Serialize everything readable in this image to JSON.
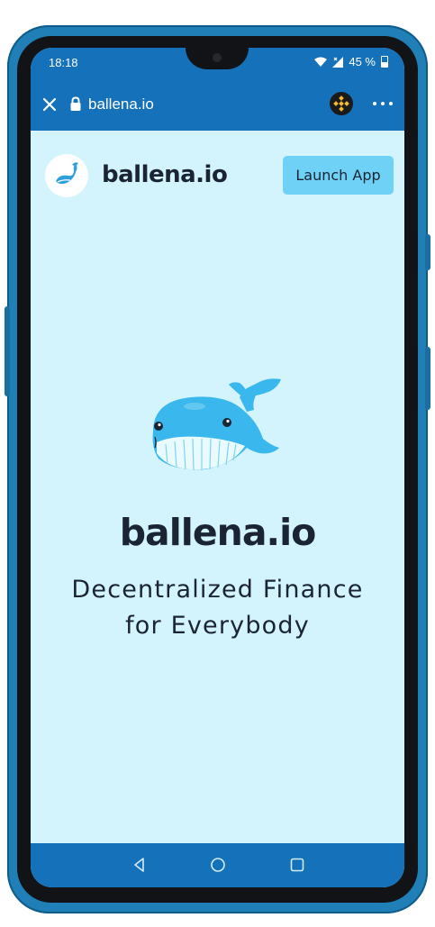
{
  "status_bar": {
    "time": "18:18",
    "battery": "45 %",
    "icons": [
      "wifi-icon",
      "signal-icon",
      "battery-icon"
    ]
  },
  "browser_bar": {
    "url": "ballena.io",
    "icons": [
      "close-icon",
      "lock-icon",
      "binance-icon",
      "more-icon"
    ]
  },
  "header": {
    "brand": "ballena.io",
    "launch_button": "Launch App"
  },
  "hero": {
    "title": "ballena.io",
    "subtitle_line1": "Decentralized Finance",
    "subtitle_line2": "for Everybody"
  },
  "nav_bar": {
    "icons": [
      "back-icon",
      "home-icon",
      "recents-icon"
    ]
  },
  "colors": {
    "chrome_blue": "#1571b9",
    "page_background": "#d3f3fd",
    "button_cyan": "#6fd1f5",
    "text_dark": "#1b2433",
    "whale_blue": "#39b6ea"
  }
}
